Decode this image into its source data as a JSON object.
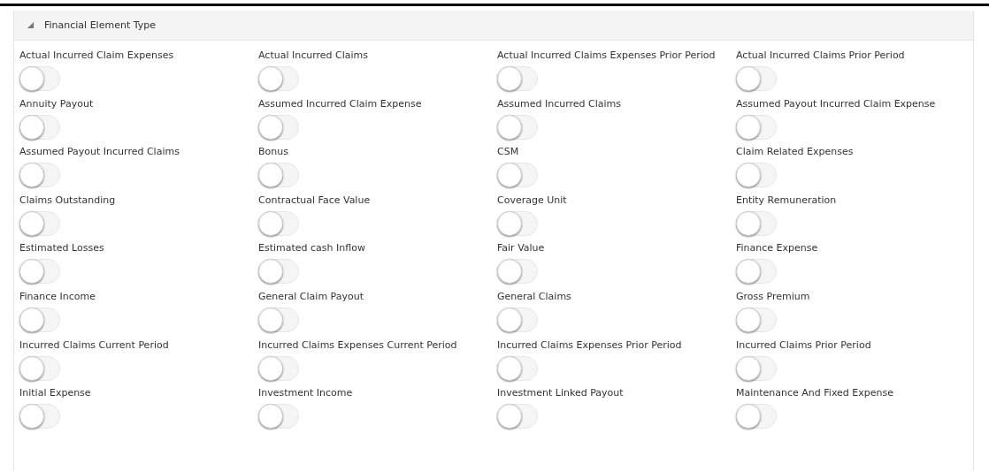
{
  "section": {
    "title": "Financial Element Type",
    "expanded": true,
    "items": [
      {
        "label": "Actual Incurred Claim Expenses",
        "on": false
      },
      {
        "label": "Actual Incurred Claims",
        "on": false
      },
      {
        "label": "Actual Incurred Claims Expenses Prior Period",
        "on": false
      },
      {
        "label": "Actual Incurred Claims Prior Period",
        "on": false
      },
      {
        "label": "Annuity Payout",
        "on": false
      },
      {
        "label": "Assumed Incurred Claim Expense",
        "on": false
      },
      {
        "label": "Assumed Incurred Claims",
        "on": false
      },
      {
        "label": "Assumed Payout Incurred Claim Expense",
        "on": false
      },
      {
        "label": "Assumed Payout Incurred Claims",
        "on": false
      },
      {
        "label": "Bonus",
        "on": false
      },
      {
        "label": "CSM",
        "on": false
      },
      {
        "label": "Claim Related Expenses",
        "on": false
      },
      {
        "label": "Claims Outstanding",
        "on": false
      },
      {
        "label": "Contractual Face Value",
        "on": false
      },
      {
        "label": "Coverage Unit",
        "on": false
      },
      {
        "label": "Entity Remuneration",
        "on": false
      },
      {
        "label": "Estimated Losses",
        "on": false
      },
      {
        "label": "Estimated cash Inflow",
        "on": false
      },
      {
        "label": "Fair Value",
        "on": false
      },
      {
        "label": "Finance Expense",
        "on": false
      },
      {
        "label": "Finance Income",
        "on": false
      },
      {
        "label": "General Claim Payout",
        "on": false
      },
      {
        "label": "General Claims",
        "on": false
      },
      {
        "label": "Gross Premium",
        "on": false
      },
      {
        "label": "Incurred Claims Current Period",
        "on": false
      },
      {
        "label": "Incurred Claims Expenses Current Period",
        "on": false
      },
      {
        "label": "Incurred Claims Expenses Prior Period",
        "on": false
      },
      {
        "label": "Incurred Claims Prior Period",
        "on": false
      },
      {
        "label": "Initial Expense",
        "on": false
      },
      {
        "label": "Investment Income",
        "on": false
      },
      {
        "label": "Investment Linked Payout",
        "on": false
      },
      {
        "label": "Maintenance And Fixed Expense",
        "on": false
      }
    ]
  }
}
